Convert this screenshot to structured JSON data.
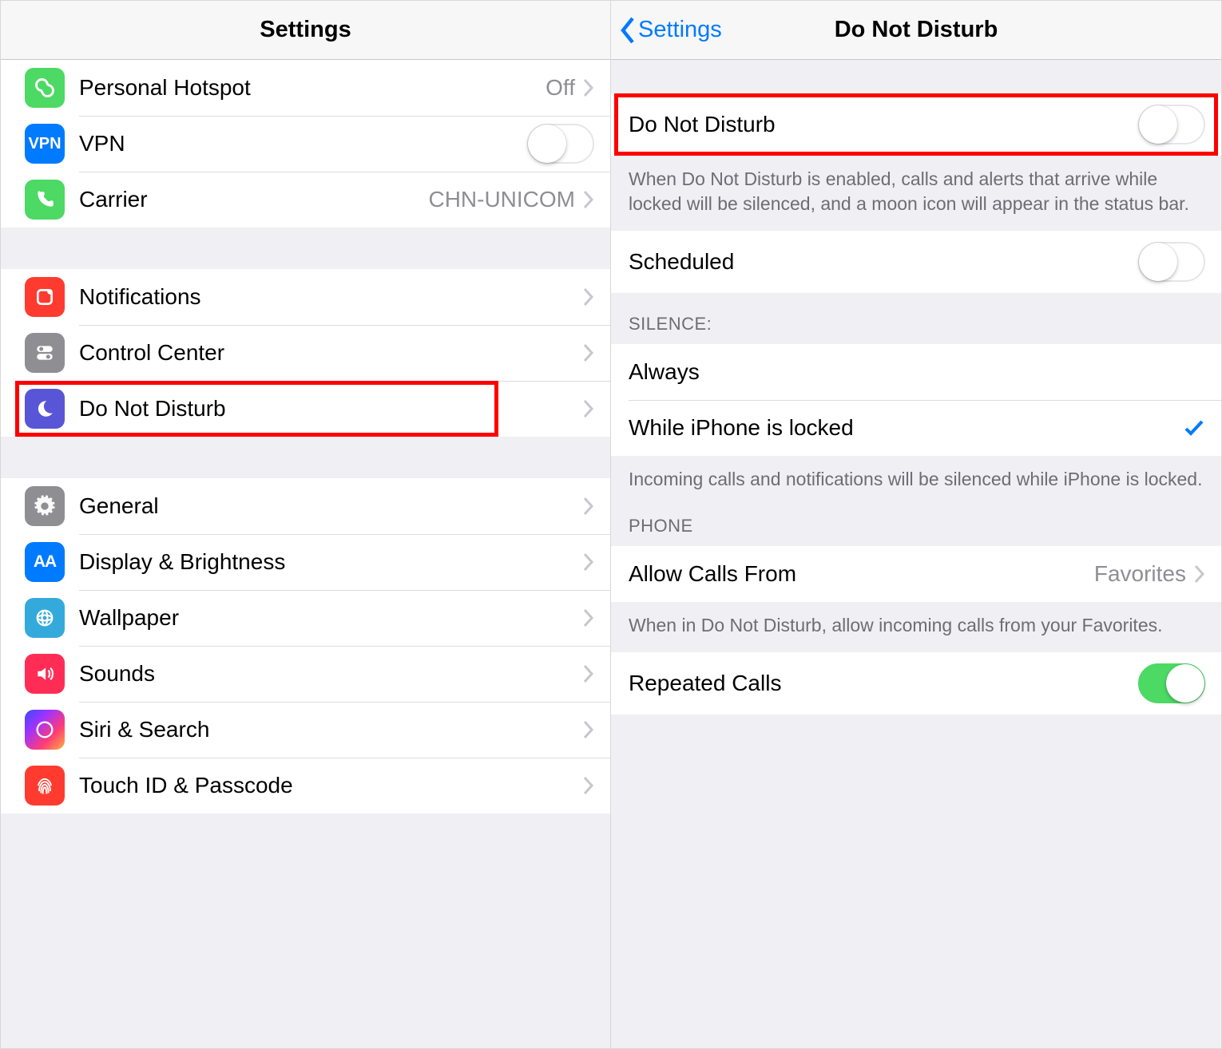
{
  "left": {
    "title": "Settings",
    "rows": {
      "personal_hotspot": {
        "label": "Personal Hotspot",
        "value": "Off"
      },
      "vpn": {
        "label": "VPN"
      },
      "carrier": {
        "label": "Carrier",
        "value": "CHN-UNICOM"
      },
      "notifications": {
        "label": "Notifications"
      },
      "control_center": {
        "label": "Control Center"
      },
      "dnd": {
        "label": "Do Not Disturb"
      },
      "general": {
        "label": "General"
      },
      "display": {
        "label": "Display & Brightness"
      },
      "wallpaper": {
        "label": "Wallpaper"
      },
      "sounds": {
        "label": "Sounds"
      },
      "siri": {
        "label": "Siri & Search"
      },
      "touchid": {
        "label": "Touch ID & Passcode"
      }
    }
  },
  "right": {
    "back_label": "Settings",
    "title": "Do Not Disturb",
    "dnd_toggle": {
      "label": "Do Not Disturb",
      "on": false
    },
    "dnd_footer": "When Do Not Disturb is enabled, calls and alerts that arrive while locked will be silenced, and a moon icon will appear in the status bar.",
    "scheduled": {
      "label": "Scheduled",
      "on": false
    },
    "silence_header": "SILENCE:",
    "silence_options": {
      "always": "Always",
      "locked": "While iPhone is locked"
    },
    "silence_footer": "Incoming calls and notifications will be silenced while iPhone is locked.",
    "phone_header": "PHONE",
    "allow_calls": {
      "label": "Allow Calls From",
      "value": "Favorites"
    },
    "allow_calls_footer": "When in Do Not Disturb, allow incoming calls from your Favorites.",
    "repeated_calls": {
      "label": "Repeated Calls",
      "on": true
    }
  }
}
